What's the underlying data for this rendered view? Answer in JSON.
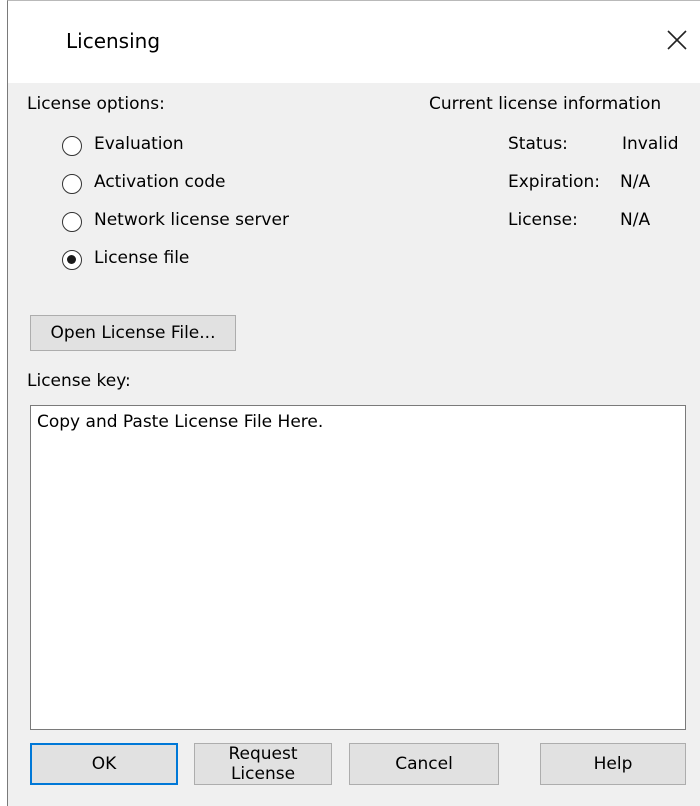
{
  "window": {
    "title": "Licensing",
    "close_icon": "close-icon"
  },
  "license_options": {
    "heading": "License options:",
    "options": [
      {
        "label": "Evaluation",
        "checked": false
      },
      {
        "label": "Activation code",
        "checked": false
      },
      {
        "label": "Network license server",
        "checked": false
      },
      {
        "label": "License file",
        "checked": true
      }
    ]
  },
  "current_info": {
    "heading": "Current license information",
    "status_label": "Status:",
    "status_value": "Invalid",
    "expiration_label": "Expiration:",
    "expiration_value": "N/A",
    "license_label": "License:",
    "license_value": "N/A"
  },
  "open_file_button": "Open License File...",
  "license_key": {
    "label": "License key:",
    "value": "Copy and Paste License File Here."
  },
  "buttons": {
    "ok": "OK",
    "request": "Request License",
    "cancel": "Cancel",
    "help": "Help"
  },
  "colors": {
    "default_button_border": "#0078d7",
    "dialog_background": "#f0f0f0",
    "titlebar_background": "#ffffff"
  }
}
